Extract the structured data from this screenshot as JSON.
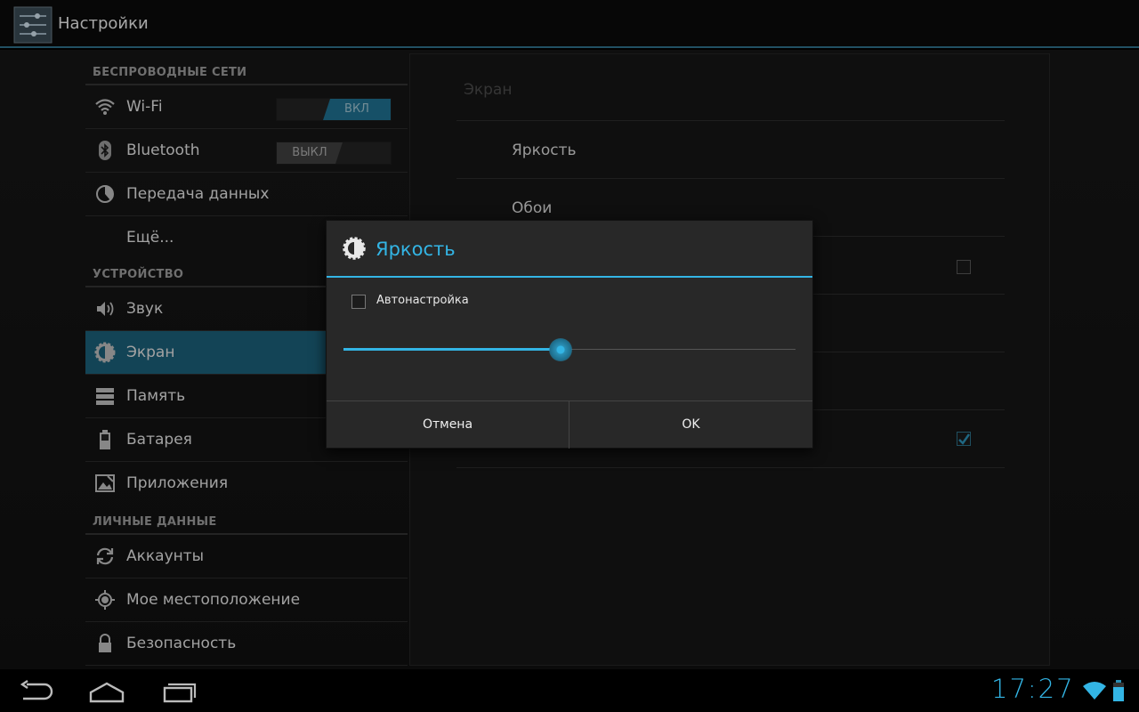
{
  "app": {
    "title": "Настройки"
  },
  "sidebar": {
    "sections": [
      {
        "header": "БЕСПРОВОДНЫЕ СЕТИ",
        "items": [
          {
            "label": "Wi-Fi",
            "icon": "wifi-icon",
            "toggle": "ВКЛ",
            "toggle_state": "on"
          },
          {
            "label": "Bluetooth",
            "icon": "bluetooth-icon",
            "toggle": "ВЫКЛ",
            "toggle_state": "off"
          },
          {
            "label": "Передача данных",
            "icon": "data-usage-icon"
          },
          {
            "label": "Ещё..."
          }
        ]
      },
      {
        "header": "УСТРОЙСТВО",
        "items": [
          {
            "label": "Звук",
            "icon": "speaker-icon"
          },
          {
            "label": "Экран",
            "icon": "brightness-icon",
            "selected": true
          },
          {
            "label": "Память",
            "icon": "storage-icon"
          },
          {
            "label": "Батарея",
            "icon": "battery-icon"
          },
          {
            "label": "Приложения",
            "icon": "apps-icon"
          }
        ]
      },
      {
        "header": "ЛИЧНЫЕ ДАННЫЕ",
        "items": [
          {
            "label": "Аккаунты",
            "icon": "sync-icon"
          },
          {
            "label": "Мое местоположение",
            "icon": "location-icon"
          },
          {
            "label": "Безопасность",
            "icon": "lock-icon"
          }
        ]
      }
    ]
  },
  "details": {
    "title": "Экран",
    "items": [
      {
        "label": "Яркость"
      },
      {
        "label": "Обои"
      }
    ]
  },
  "dialog": {
    "title": "Яркость",
    "auto_label": "Автонастройка",
    "auto_checked": false,
    "brightness_fraction": 0.48,
    "cancel_label": "Отмена",
    "ok_label": "OK"
  },
  "system_bar": {
    "clock": "17:27",
    "nav": [
      "back-icon",
      "home-icon",
      "recent-apps-icon"
    ]
  },
  "colors": {
    "accent": "#33b5e5",
    "selected": "#1b5f78"
  }
}
